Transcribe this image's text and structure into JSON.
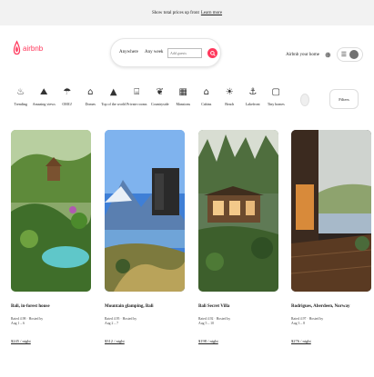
{
  "banner": {
    "text": "Show total prices up front",
    "link": "Learn more"
  },
  "brand": {
    "name": "airbnb",
    "accent": "#ff385c"
  },
  "search": {
    "where": "Anywhere",
    "week": "Any week",
    "guests_placeholder": "Add guests"
  },
  "header_right": {
    "host_link": "Airbnb your home",
    "globe_icon": "globe-icon",
    "menu_icon": "hamburger-icon"
  },
  "categories": [
    {
      "label": "Trending",
      "icon": "♨"
    },
    {
      "label": "Amazing views",
      "icon": "⛰"
    },
    {
      "label": "OMG!",
      "icon": "☂"
    },
    {
      "label": "Domes",
      "icon": "⌂"
    },
    {
      "label": "Top of the world",
      "icon": "▲"
    },
    {
      "label": "Private rooms",
      "icon": "⌸"
    },
    {
      "label": "Countryside",
      "icon": "❦"
    },
    {
      "label": "Mansions",
      "icon": "▦"
    },
    {
      "label": "Cabins",
      "icon": "⌂"
    },
    {
      "label": "Beach",
      "icon": "☀"
    },
    {
      "label": "Lakefront",
      "icon": "⚓"
    },
    {
      "label": "Tiny homes",
      "icon": "▢"
    }
  ],
  "filters_label": "Filters",
  "listings": [
    {
      "title": "Bali, in-forest house",
      "meta1": "Rated 4.98 · Hosted by",
      "meta2": "Aug 1 – 6",
      "price": "$245 / night"
    },
    {
      "title": "Mountain glamping, Bali",
      "meta1": "Rated 4.95 · Hosted by",
      "meta2": "Aug 2 – 7",
      "price": "$312 / night"
    },
    {
      "title": "Bali Secret Villa",
      "meta1": "Rated 4.92 · Hosted by",
      "meta2": "Aug 5 – 10",
      "price": "$198 / night"
    },
    {
      "title": "Rodrigues, Aberdeen, Norway",
      "meta1": "Rated 4.97 · Hosted by",
      "meta2": "Aug 3 – 8",
      "price": "$276 / night"
    }
  ]
}
